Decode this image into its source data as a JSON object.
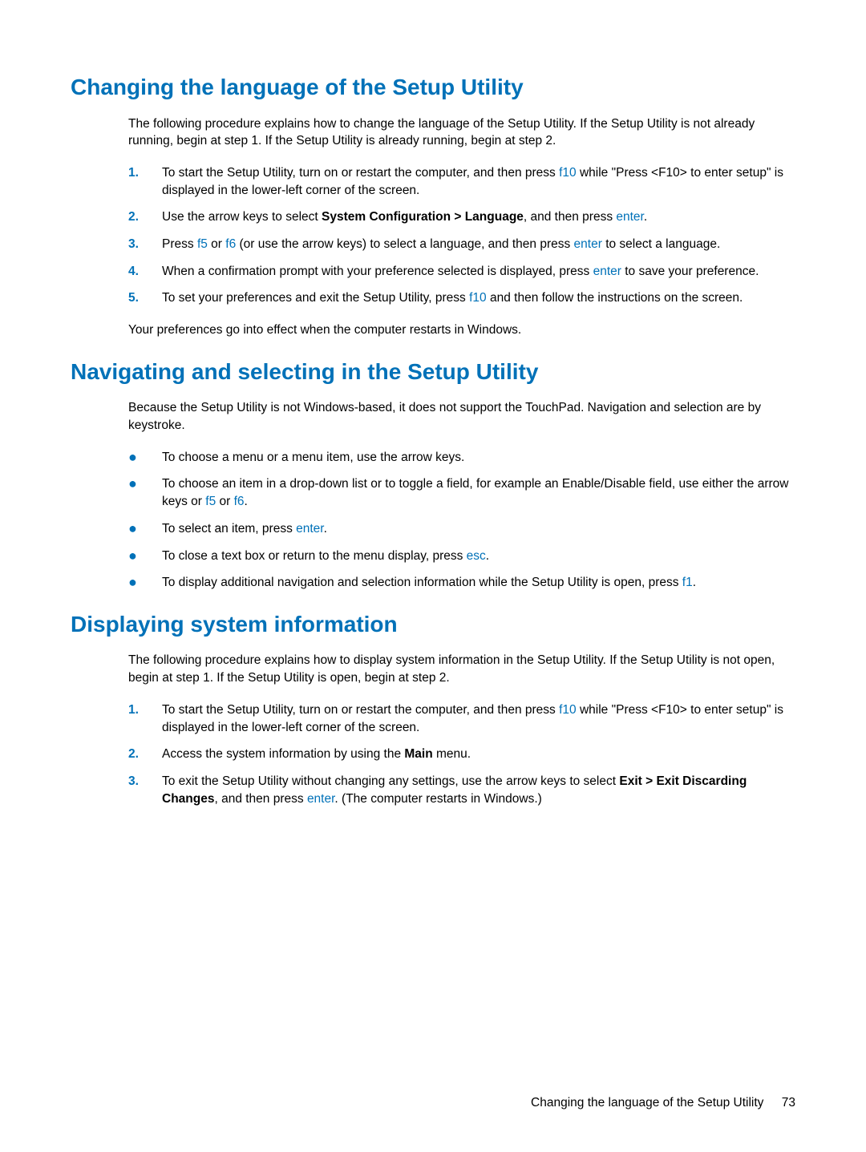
{
  "section1": {
    "heading": "Changing the language of the Setup Utility",
    "intro": "The following procedure explains how to change the language of the Setup Utility. If the Setup Utility is not already running, begin at step 1. If the Setup Utility is already running, begin at step 2.",
    "steps": [
      {
        "num": "1.",
        "pre1": "To start the Setup Utility, turn on or restart the computer, and then press ",
        "key1": "f10",
        "post1": " while \"Press <F10> to enter setup\" is displayed in the lower-left corner of the screen."
      },
      {
        "num": "2.",
        "pre1": "Use the arrow keys to select ",
        "bold1": "System Configuration > Language",
        "mid1": ", and then press ",
        "key1": "enter",
        "post1": "."
      },
      {
        "num": "3.",
        "pre1": "Press ",
        "key1": "f5",
        "mid1": " or ",
        "key2": "f6",
        "mid2": " (or use the arrow keys) to select a language, and then press ",
        "key3": "enter",
        "post1": " to select a language."
      },
      {
        "num": "4.",
        "pre1": "When a confirmation prompt with your preference selected is displayed, press ",
        "key1": "enter",
        "post1": " to save your preference."
      },
      {
        "num": "5.",
        "pre1": "To set your preferences and exit the Setup Utility, press ",
        "key1": "f10",
        "post1": " and then follow the instructions on the screen."
      }
    ],
    "outro": "Your preferences go into effect when the computer restarts in Windows."
  },
  "section2": {
    "heading": "Navigating and selecting in the Setup Utility",
    "intro": "Because the Setup Utility is not Windows-based, it does not support the TouchPad. Navigation and selection are by keystroke.",
    "bullets": [
      {
        "pre1": "To choose a menu or a menu item, use the arrow keys."
      },
      {
        "pre1": "To choose an item in a drop-down list or to toggle a field, for example an Enable/Disable field, use either the arrow keys or ",
        "key1": "f5",
        "mid1": " or ",
        "key2": "f6",
        "post1": "."
      },
      {
        "pre1": "To select an item, press ",
        "key1": "enter",
        "post1": "."
      },
      {
        "pre1": "To close a text box or return to the menu display, press ",
        "key1": "esc",
        "post1": "."
      },
      {
        "pre1": "To display additional navigation and selection information while the Setup Utility is open, press ",
        "key1": "f1",
        "post1": "."
      }
    ]
  },
  "section3": {
    "heading": "Displaying system information",
    "intro": "The following procedure explains how to display system information in the Setup Utility. If the Setup Utility is not open, begin at step 1. If the Setup Utility is open, begin at step 2.",
    "steps": [
      {
        "num": "1.",
        "pre1": "To start the Setup Utility, turn on or restart the computer, and then press ",
        "key1": "f10",
        "post1": " while \"Press <F10> to enter setup\" is displayed in the lower-left corner of the screen."
      },
      {
        "num": "2.",
        "pre1": "Access the system information by using the ",
        "bold1": "Main",
        "post1": " menu."
      },
      {
        "num": "3.",
        "pre1": "To exit the Setup Utility without changing any settings, use the arrow keys to select ",
        "bold1": "Exit > Exit Discarding Changes",
        "mid1": ", and then press ",
        "key1": "enter",
        "post1": ". (The computer restarts in Windows.)"
      }
    ]
  },
  "footer": {
    "text": "Changing the language of the Setup Utility",
    "page": "73"
  },
  "bullet_char": "●"
}
